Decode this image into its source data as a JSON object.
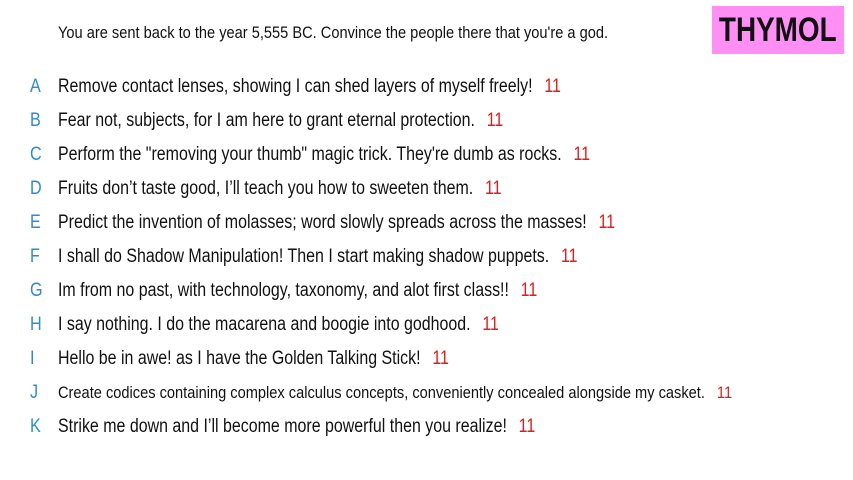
{
  "header": {
    "prompt": "You are sent back to the year 5,555 BC. Convince the people there that you're a god.",
    "logo_text": "THYMOL"
  },
  "colors": {
    "letter": "#2a8cd8",
    "score": "#e51b1b",
    "logo_bg": "#ff8ef5"
  },
  "answers": [
    {
      "letter": "A",
      "text": "Remove contact lenses, showing I can shed layers of myself freely!",
      "score": "11"
    },
    {
      "letter": "B",
      "text": "Fear not, subjects, for I am here to grant eternal protection.",
      "score": "11"
    },
    {
      "letter": "C",
      "text": "Perform the \"removing your thumb\" magic trick. They're dumb as rocks.",
      "score": "11"
    },
    {
      "letter": "D",
      "text": "Fruits don’t taste good, I’ll teach you how to sweeten them.",
      "score": "11"
    },
    {
      "letter": "E",
      "text": "Predict the invention of molasses; word slowly spreads across the masses!",
      "score": "11"
    },
    {
      "letter": "F",
      "text": "I shall do Shadow Manipulation! Then I start making shadow puppets.",
      "score": "11"
    },
    {
      "letter": "G",
      "text": "Im from no past, with technology, taxonomy, and alot first class!!",
      "score": "11"
    },
    {
      "letter": "H",
      "text": "I say nothing. I do the macarena and boogie into godhood.",
      "score": "11"
    },
    {
      "letter": "I",
      "text": "Hello be in awe! as I have the Golden Talking Stick!",
      "score": "11"
    },
    {
      "letter": "J",
      "text": "Create codices containing complex calculus concepts, conveniently concealed alongside my casket.",
      "score": "11"
    },
    {
      "letter": "K",
      "text": "Strike me down and I’ll become more powerful then you realize!",
      "score": "11"
    }
  ]
}
